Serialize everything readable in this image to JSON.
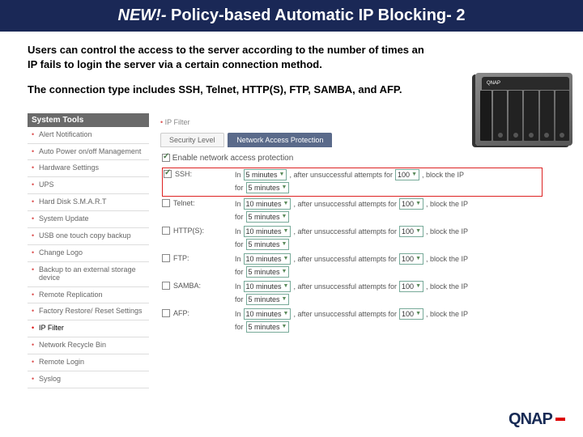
{
  "title": {
    "new": "NEW!-",
    "rest": " Policy-based Automatic IP Blocking- 2"
  },
  "desc1": "Users can control the access to the server according to the number of times an IP fails to login the server via a certain connection method.",
  "desc2": "The connection type includes SSH, Telnet, HTTP(S), FTP, SAMBA, and AFP.",
  "sidebar": {
    "header": "System Tools",
    "items": [
      "Alert Notification",
      "Auto Power on/off Management",
      "Hardware Settings",
      "UPS",
      "Hard Disk S.M.A.R.T",
      "System Update",
      "USB one touch copy backup",
      "Change Logo",
      "Backup to an external storage device",
      "Remote Replication",
      "Factory Restore/ Reset Settings",
      "IP Filter",
      "Network Recycle Bin",
      "Remote Login",
      "Syslog"
    ]
  },
  "breadcrumb": "IP Filter",
  "tabs": {
    "t1": "Security Level",
    "t2": "Network Access Protection"
  },
  "enable": "Enable network access protection",
  "rowtext": {
    "in": "In",
    "after": ", after unsuccessful attempts for",
    "block": ", block the IP",
    "for": "for"
  },
  "protocols": [
    {
      "name": "SSH:",
      "checked": true,
      "hl": true,
      "win": "5 minutes",
      "att": "100",
      "for": "5 minutes"
    },
    {
      "name": "Telnet:",
      "checked": false,
      "hl": false,
      "win": "10 minutes",
      "att": "100",
      "for": "5 minutes"
    },
    {
      "name": "HTTP(S):",
      "checked": false,
      "hl": false,
      "win": "10 minutes",
      "att": "100",
      "for": "5 minutes"
    },
    {
      "name": "FTP:",
      "checked": false,
      "hl": false,
      "win": "10 minutes",
      "att": "100",
      "for": "5 minutes"
    },
    {
      "name": "SAMBA:",
      "checked": false,
      "hl": false,
      "win": "10 minutes",
      "att": "100",
      "for": "5 minutes"
    },
    {
      "name": "AFP:",
      "checked": false,
      "hl": false,
      "win": "10 minutes",
      "att": "100",
      "for": "5 minutes"
    }
  ],
  "logo": "QNAP"
}
